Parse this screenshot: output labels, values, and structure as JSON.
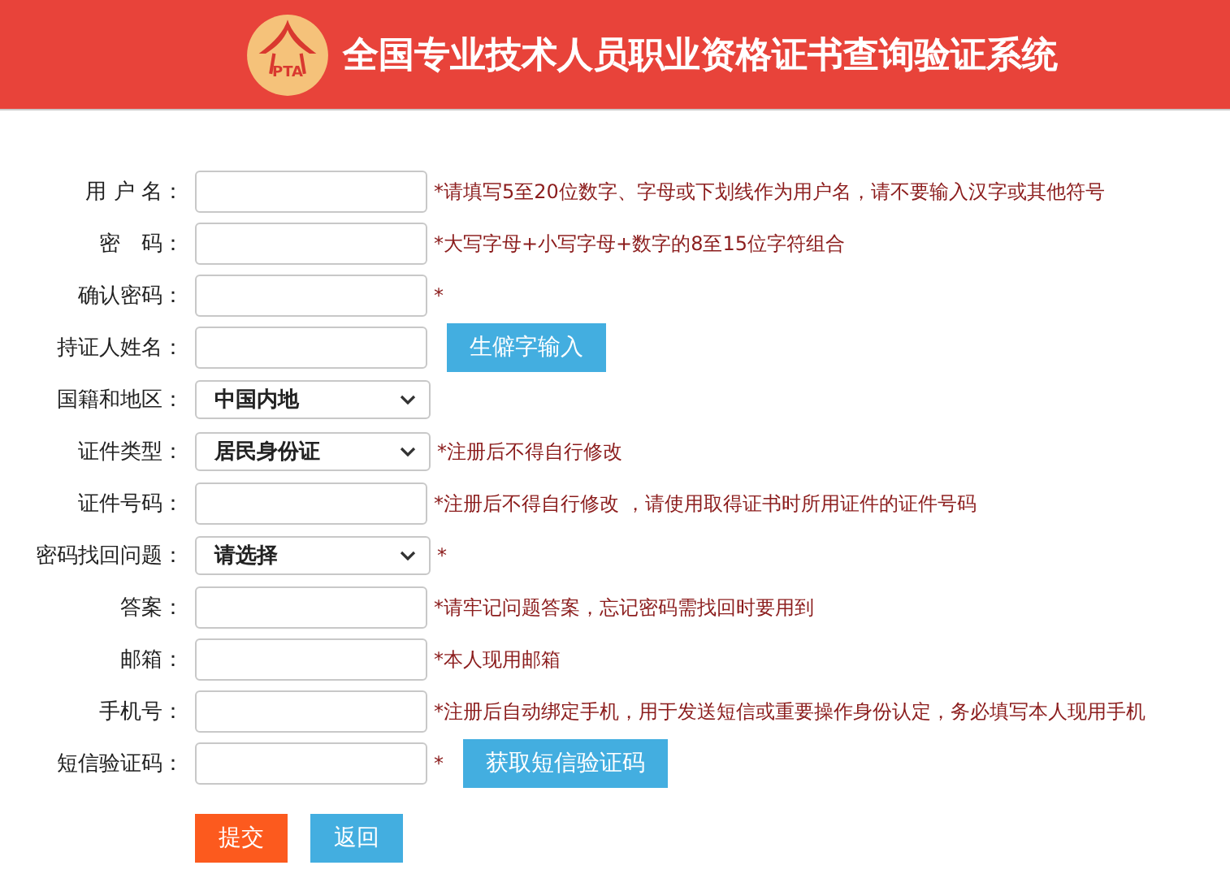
{
  "header": {
    "logo_text": "PTA",
    "title": "全国专业技术人员职业资格证书查询验证系统"
  },
  "fields": [
    {
      "label": "用 户 名：",
      "kind": "input",
      "hint": "*请填写5至20位数字、字母或下划线作为用户名，请不要输入汉字或其他符号"
    },
    {
      "label": "密　码：",
      "kind": "input",
      "hint": "*大写字母+小写字母+数字的8至15位字符组合"
    },
    {
      "label": "确认密码：",
      "kind": "input",
      "hint": "*"
    },
    {
      "label": "持证人姓名：",
      "kind": "input",
      "button": "生僻字输入"
    },
    {
      "label": "国籍和地区：",
      "kind": "select",
      "value": "中国内地"
    },
    {
      "label": "证件类型：",
      "kind": "select",
      "value": "居民身份证",
      "hint": "*注册后不得自行修改"
    },
    {
      "label": "证件号码：",
      "kind": "input",
      "hint": "*注册后不得自行修改 ，请使用取得证书时所用证件的证件号码"
    },
    {
      "label": "密码找回问题：",
      "kind": "select",
      "value": "请选择",
      "hint": "*"
    },
    {
      "label": "答案：",
      "kind": "input",
      "hint": "*请牢记问题答案，忘记密码需找回时要用到"
    },
    {
      "label": "邮箱：",
      "kind": "input",
      "hint": "*本人现用邮箱"
    },
    {
      "label": "手机号：",
      "kind": "input",
      "hint": "*注册后自动绑定手机，用于发送短信或重要操作身份认定，务必填写本人现用手机"
    },
    {
      "label": "短信验证码：",
      "kind": "input",
      "hint": "*",
      "button": "获取短信验证码"
    }
  ],
  "actions": [
    {
      "label": "提交",
      "kind": "primary"
    },
    {
      "label": "返回",
      "kind": "secondary"
    }
  ]
}
